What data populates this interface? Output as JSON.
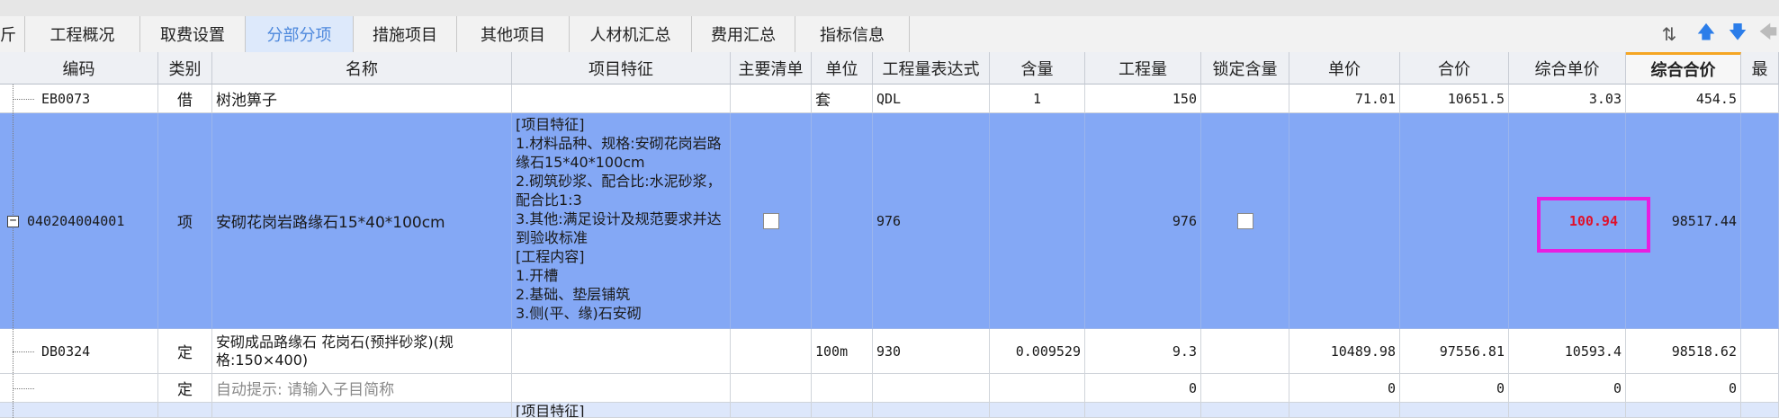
{
  "tabs": [
    {
      "label": "斤",
      "active": false
    },
    {
      "label": "工程概况",
      "active": false
    },
    {
      "label": "取费设置",
      "active": false
    },
    {
      "label": "分部分项",
      "active": true
    },
    {
      "label": "措施项目",
      "active": false
    },
    {
      "label": "其他项目",
      "active": false
    },
    {
      "label": "人材机汇总",
      "active": false
    },
    {
      "label": "费用汇总",
      "active": false
    },
    {
      "label": "指标信息",
      "active": false
    }
  ],
  "toolbar_icons": [
    "sort-icon",
    "arrow-up-icon",
    "arrow-down-icon",
    "arrow-left-icon"
  ],
  "columns": [
    "编码",
    "类别",
    "名称",
    "项目特征",
    "主要清单",
    "单位",
    "工程量表达式",
    "含量",
    "工程量",
    "锁定含量",
    "单价",
    "合价",
    "综合单价",
    "综合合价",
    "最"
  ],
  "selected_column": "综合合价",
  "rows": [
    {
      "code": "EB0073",
      "type": "借",
      "name": "树池箅子",
      "feature": "",
      "main": "",
      "unit": "套",
      "expr": "QDL",
      "content": "1",
      "qty": "150",
      "lock": "",
      "price": "71.01",
      "total": "10651.5",
      "comp_price": "3.03",
      "comp_total": "454.5"
    },
    {
      "code": "040204004001",
      "type": "项",
      "name": "安砌花岗岩路缘石15*40*100cm",
      "feature": "[项目特征]\n1.材料品种、规格:安砌花岗岩路缘石15*40*100cm\n2.砌筑砂浆、配合比:水泥砂浆，配合比1:3\n3.其他:满足设计及规范要求并达到验收标准\n[工程内容]\n1.开槽\n2.基础、垫层铺筑\n3.侧(平、缘)石安砌",
      "main": "checkbox",
      "unit": "",
      "expr": "976",
      "content": "",
      "qty": "976",
      "lock": "checkbox",
      "price": "",
      "total": "",
      "comp_price": "100.94",
      "comp_total": "98517.44"
    },
    {
      "code": "DB0324",
      "type": "定",
      "name": "安砌成品路缘石 花岗石(预拌砂浆)(规格:150×400)",
      "feature": "",
      "main": "",
      "unit": "100m",
      "expr": "930",
      "content": "0.009529",
      "qty": "9.3",
      "lock": "",
      "price": "10489.98",
      "total": "97556.81",
      "comp_price": "10593.4",
      "comp_total": "98518.62"
    },
    {
      "code": "",
      "type": "定",
      "name": "自动提示: 请输入子目简称",
      "feature": "",
      "main": "",
      "unit": "",
      "expr": "",
      "content": "",
      "qty": "0",
      "lock": "",
      "price": "0",
      "total": "0",
      "comp_price": "0",
      "comp_total": "0"
    },
    {
      "code": "",
      "type": "",
      "name": "",
      "feature": "[项目特征]",
      "main": "",
      "unit": "",
      "expr": "",
      "content": "",
      "qty": "",
      "lock": "",
      "price": "",
      "total": "",
      "comp_price": "",
      "comp_total": ""
    }
  ]
}
